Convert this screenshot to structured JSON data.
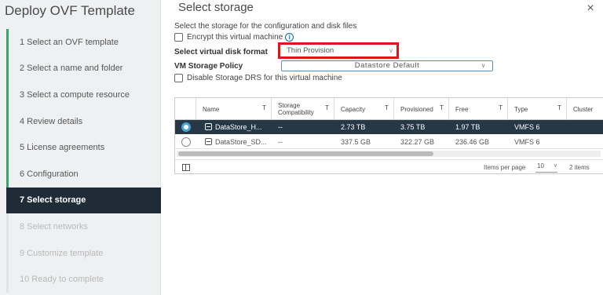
{
  "wizard": {
    "title": "Deploy OVF Template",
    "steps": [
      {
        "label": "1  Select an OVF template",
        "state": "done"
      },
      {
        "label": "2  Select a name and folder",
        "state": "done"
      },
      {
        "label": "3  Select a compute resource",
        "state": "done"
      },
      {
        "label": "4  Review details",
        "state": "done"
      },
      {
        "label": "5  License agreements",
        "state": "done"
      },
      {
        "label": "6  Configuration",
        "state": "done"
      },
      {
        "label": "7  Select storage",
        "state": "current"
      },
      {
        "label": "8  Select networks",
        "state": "future"
      },
      {
        "label": "9  Customize template",
        "state": "future"
      },
      {
        "label": "10  Ready to complete",
        "state": "future"
      }
    ]
  },
  "page": {
    "title": "Select storage",
    "close_icon": "×",
    "subtitle": "Select the storage for the configuration and disk files",
    "encrypt_label": "Encrypt this virtual machine",
    "info_icon": "i",
    "disk_format_label": "Select virtual disk format",
    "disk_format_value": "Thin Provision",
    "storage_policy_label": "VM Storage Policy",
    "storage_policy_value": "Datastore Default",
    "disable_drs_label": "Disable Storage DRS for this virtual machine",
    "highlight_color": "#e1141b"
  },
  "grid": {
    "columns": [
      "Name",
      "Storage Compatibility",
      "Capacity",
      "Provisioned",
      "Free",
      "Type",
      "Cluster"
    ],
    "filter_icon": "T",
    "rows": [
      {
        "name": "DataStore_H...",
        "compat": "--",
        "capacity": "2.73 TB",
        "provisioned": "3.75 TB",
        "free": "1.97 TB",
        "type": "VMFS 6",
        "selected": true
      },
      {
        "name": "DataStore_SD...",
        "compat": "--",
        "capacity": "337.5 GB",
        "provisioned": "322.27 GB",
        "free": "236.46 GB",
        "type": "VMFS 6",
        "selected": false
      }
    ],
    "footer": {
      "per_page_label": "Items per page",
      "per_page_value": "10",
      "count": "2 items"
    }
  }
}
